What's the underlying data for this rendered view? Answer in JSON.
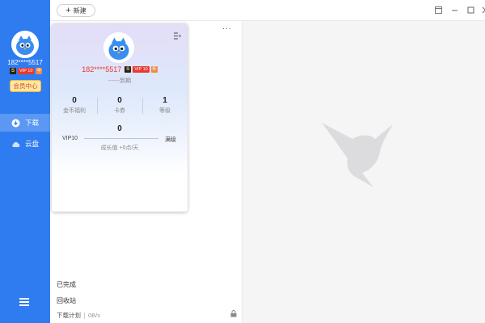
{
  "sidebar": {
    "username": "182****5517",
    "badges": {
      "s": "S",
      "vip": "VIP 10",
      "year": "年"
    },
    "vip_center": "会员中心",
    "nav": [
      {
        "label": "下载",
        "icon": "download-icon",
        "active": true
      },
      {
        "label": "云盘",
        "icon": "cloud-icon",
        "active": false
      }
    ],
    "menu_icon": "menu-icon"
  },
  "toolbar": {
    "new_label": "新建",
    "new_icon": "plus-icon"
  },
  "window_controls": {
    "icons": [
      "restore-icon",
      "minimize-icon",
      "maximize-icon",
      "close-icon"
    ]
  },
  "list": {
    "more_icon": "···",
    "completed": "已完成",
    "recycle": "回收站",
    "plan": "下载计划",
    "speed": "0B/s"
  },
  "profile_card": {
    "username": "182****5517",
    "badges": {
      "s": "S",
      "vip": "VIP 10",
      "year": "年"
    },
    "expire": "------到期",
    "stats": [
      {
        "value": "0",
        "label": "金币福利"
      },
      {
        "value": "0",
        "label": "卡券"
      },
      {
        "value": "1",
        "label": "等级"
      }
    ],
    "growth": {
      "value": "0",
      "level_left": "VIP10",
      "level_right": "满级",
      "rate": "成长值 +0点/天",
      "progress": 0
    }
  },
  "colors": {
    "sidebar": "#2f7cf0",
    "sidebar_active": "#5a98f3",
    "username_red": "#e8392f",
    "vip_button_bg": "#ffe7a6",
    "right_bg": "#f5f5f6"
  }
}
